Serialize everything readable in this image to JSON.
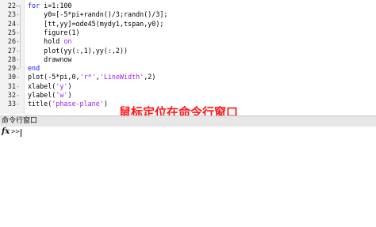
{
  "editor": {
    "lines": [
      {
        "num": "22",
        "dash": "—",
        "code": [
          {
            "t": "for",
            "c": "kw"
          },
          {
            "t": " i=1:100",
            "c": ""
          }
        ]
      },
      {
        "num": "23",
        "dash": "-",
        "code": [
          {
            "t": "    y0=[-5*pi+randn()/3;randn()/3];",
            "c": ""
          }
        ]
      },
      {
        "num": "24",
        "dash": "-",
        "code": [
          {
            "t": "    [tt,yy]=ode45(mydy1,tspan,y0);",
            "c": ""
          }
        ]
      },
      {
        "num": "25",
        "dash": "-",
        "code": [
          {
            "t": "    figure(1)",
            "c": ""
          }
        ]
      },
      {
        "num": "26",
        "dash": "-",
        "code": [
          {
            "t": "    hold ",
            "c": ""
          },
          {
            "t": "on",
            "c": "str"
          }
        ]
      },
      {
        "num": "27",
        "dash": "-",
        "code": [
          {
            "t": "    plot(yy(:,1),yy(:,2))",
            "c": ""
          }
        ]
      },
      {
        "num": "28",
        "dash": "-",
        "code": [
          {
            "t": "    drawnow",
            "c": ""
          }
        ]
      },
      {
        "num": "29",
        "dash": "-",
        "code": [
          {
            "t": "end",
            "c": "kw"
          }
        ]
      },
      {
        "num": "30",
        "dash": "-",
        "code": [
          {
            "t": "plot(-5*pi,0,",
            "c": ""
          },
          {
            "t": "'r*'",
            "c": "str"
          },
          {
            "t": ",",
            "c": ""
          },
          {
            "t": "'LineWidth'",
            "c": "str"
          },
          {
            "t": ",2)",
            "c": ""
          }
        ]
      },
      {
        "num": "31",
        "dash": "-",
        "code": [
          {
            "t": "xlabel(",
            "c": ""
          },
          {
            "t": "'y'",
            "c": "str"
          },
          {
            "t": ")",
            "c": ""
          }
        ]
      },
      {
        "num": "32",
        "dash": "-",
        "code": [
          {
            "t": "ylabel(",
            "c": ""
          },
          {
            "t": "'w'",
            "c": "str"
          },
          {
            "t": ")",
            "c": ""
          }
        ]
      },
      {
        "num": "33",
        "dash": "-",
        "code": [
          {
            "t": "title(",
            "c": ""
          },
          {
            "t": "'phase-plane'",
            "c": "str"
          },
          {
            "t": ")",
            "c": ""
          }
        ]
      }
    ]
  },
  "annotation_text": "鼠标定位在命令行窗口",
  "command_window": {
    "title": "命令行窗口",
    "fx_label": "fx",
    "prompt": ">>"
  }
}
